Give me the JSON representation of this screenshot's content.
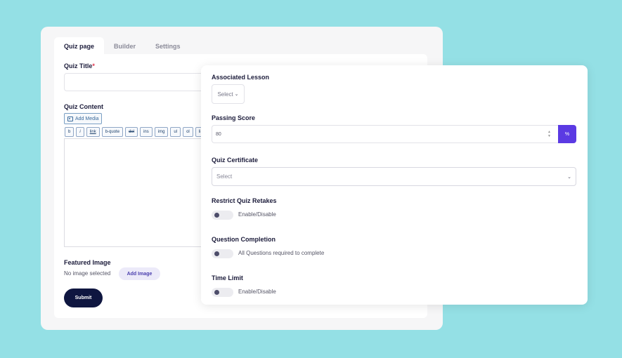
{
  "tabs": [
    "Quiz page",
    "Builder",
    "Settings"
  ],
  "quiz_page": {
    "title_label": "Quiz Title",
    "required_mark": "*",
    "content_label": "Quiz Content",
    "add_media": "Add Media",
    "quicktags": [
      "b",
      "i",
      "link",
      "b-quote",
      "del",
      "ins",
      "img",
      "ul",
      "ol",
      "li"
    ],
    "featured_label": "Featured Image",
    "no_image": "No image selected",
    "add_image": "Add Image",
    "submit": "Submit"
  },
  "settings": {
    "lesson_label": "Associated Lesson",
    "lesson_select": "Select",
    "passing_label": "Passing Score",
    "passing_value": "80",
    "percent": "%",
    "cert_label": "Quiz Certificate",
    "cert_select": "Select",
    "retakes_label": "Restrict Quiz Retakes",
    "retakes_toggle": "Enable/Disable",
    "completion_label": "Question Completion",
    "completion_toggle": "All Questions required to complete",
    "time_label": "Time Limit",
    "time_toggle": "Enable/Disable"
  },
  "icons": {
    "media": "media-icon",
    "chevron": "chevron-down-icon",
    "spinner": "number-spinner-icon"
  },
  "colors": {
    "background": "#94e0e5",
    "accent": "#5b3ae3",
    "submit": "#0f1640"
  }
}
